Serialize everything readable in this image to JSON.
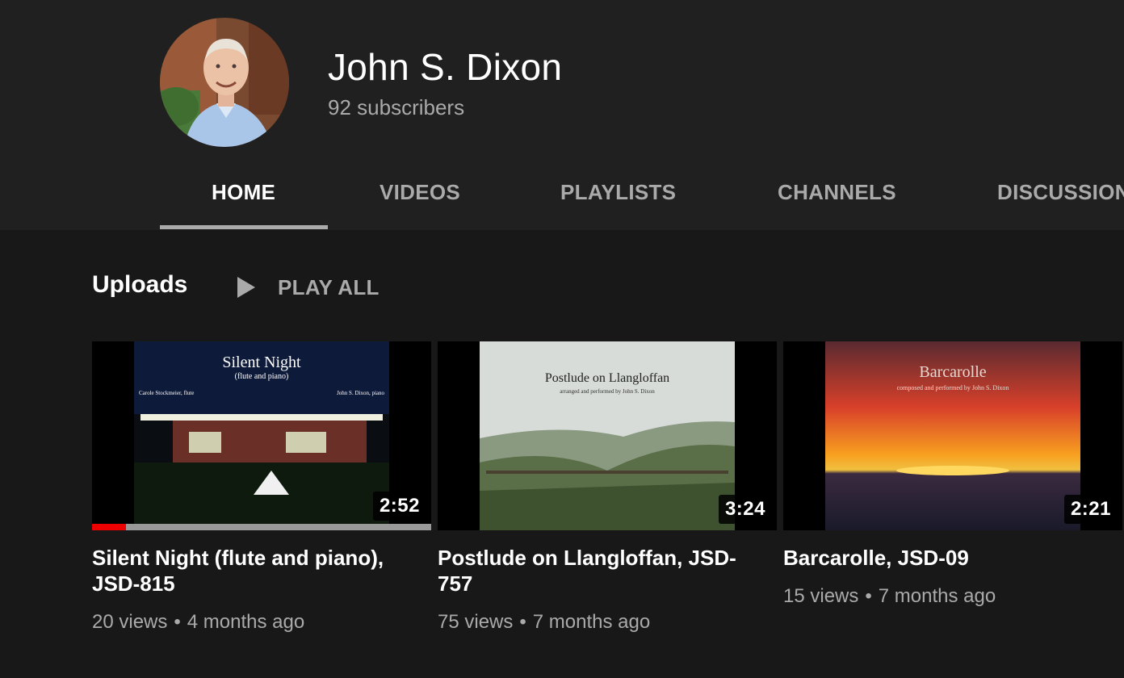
{
  "channel": {
    "name": "John S. Dixon",
    "subscribers": "92 subscribers"
  },
  "tabs": [
    {
      "label": "HOME",
      "active": true
    },
    {
      "label": "VIDEOS",
      "active": false
    },
    {
      "label": "PLAYLISTS",
      "active": false
    },
    {
      "label": "CHANNELS",
      "active": false
    },
    {
      "label": "DISCUSSION",
      "active": false
    }
  ],
  "section": {
    "title": "Uploads",
    "play_all": "PLAY ALL"
  },
  "videos": [
    {
      "title": "Silent Night (flute and piano), JSD-815",
      "duration": "2:52",
      "views": "20 views",
      "age": "4 months ago",
      "watched_fraction": 0.1,
      "thumb_title": "Silent Night",
      "thumb_subtitle": "(flute and piano)",
      "thumb_left": "Carole Stockmeier, flute",
      "thumb_right": "John S. Dixon, piano"
    },
    {
      "title": "Postlude on Llangloffan, JSD-757",
      "duration": "3:24",
      "views": "75 views",
      "age": "7 months ago",
      "thumb_title": "Postlude on Llangloffan",
      "thumb_subtitle": "arranged and performed by John S. Dixon"
    },
    {
      "title": "Barcarolle, JSD-09",
      "duration": "2:21",
      "views": "15 views",
      "age": "7 months ago",
      "thumb_title": "Barcarolle",
      "thumb_subtitle": "composed and performed by John S. Dixon"
    }
  ],
  "meta_separator": "•",
  "colors": {
    "page_bg": "#181818",
    "header_bg": "#202020",
    "text_primary": "#ffffff",
    "text_secondary": "#aaaaaa",
    "progress_red": "#ee0000"
  }
}
